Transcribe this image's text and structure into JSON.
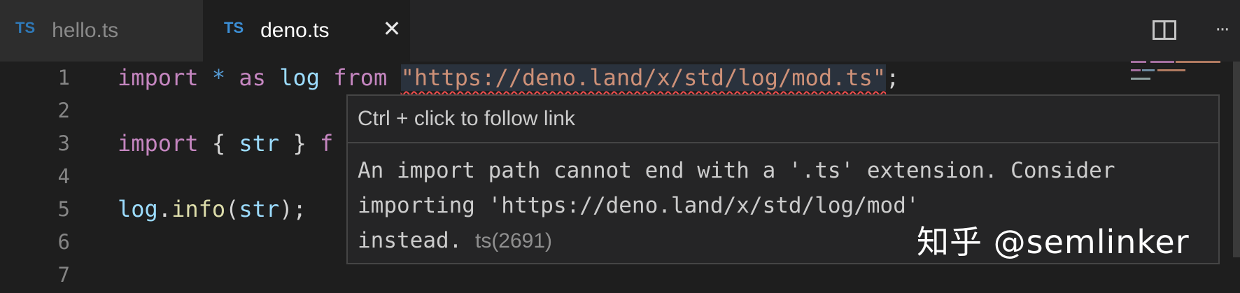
{
  "tabs": [
    {
      "badge": "TS",
      "label": "hello.ts",
      "active": false
    },
    {
      "badge": "TS",
      "label": "deno.ts",
      "active": true,
      "close_glyph": "✕"
    }
  ],
  "toolbar": {
    "split_icon": "split-editor-icon",
    "more_glyph": "···"
  },
  "editor": {
    "line_numbers": [
      "1",
      "2",
      "3",
      "4",
      "5",
      "6",
      "7"
    ],
    "lines": {
      "l1": {
        "kw1": "import",
        "star": "*",
        "as": "as",
        "name": "log",
        "from": "from",
        "path": "\"https://deno.land/x/std/log/mod.ts\"",
        "semi": ";"
      },
      "l3": {
        "kw": "import",
        "open": "{",
        "name": "str",
        "close": "}",
        "tail": "f"
      },
      "l5": {
        "obj": "log",
        "dot": ".",
        "method": "info",
        "open": "(",
        "arg": "str",
        "close": ");"
      }
    }
  },
  "hover": {
    "header": "Ctrl + click to follow link",
    "message_line1": "An import path cannot end with a '.ts' extension. Consider",
    "message_line2": "importing 'https://deno.land/x/std/log/mod'",
    "message_line3": "instead.",
    "diagnostic_code": "ts(2691)"
  },
  "watermark": "知乎 @semlinker",
  "colors": {
    "keyword": "#c586c0",
    "variable": "#9cdcfe",
    "string": "#ce9178",
    "function": "#dcdcaa",
    "ts_badge": "#3c8fd6",
    "error_squiggle": "#f14c4c"
  }
}
